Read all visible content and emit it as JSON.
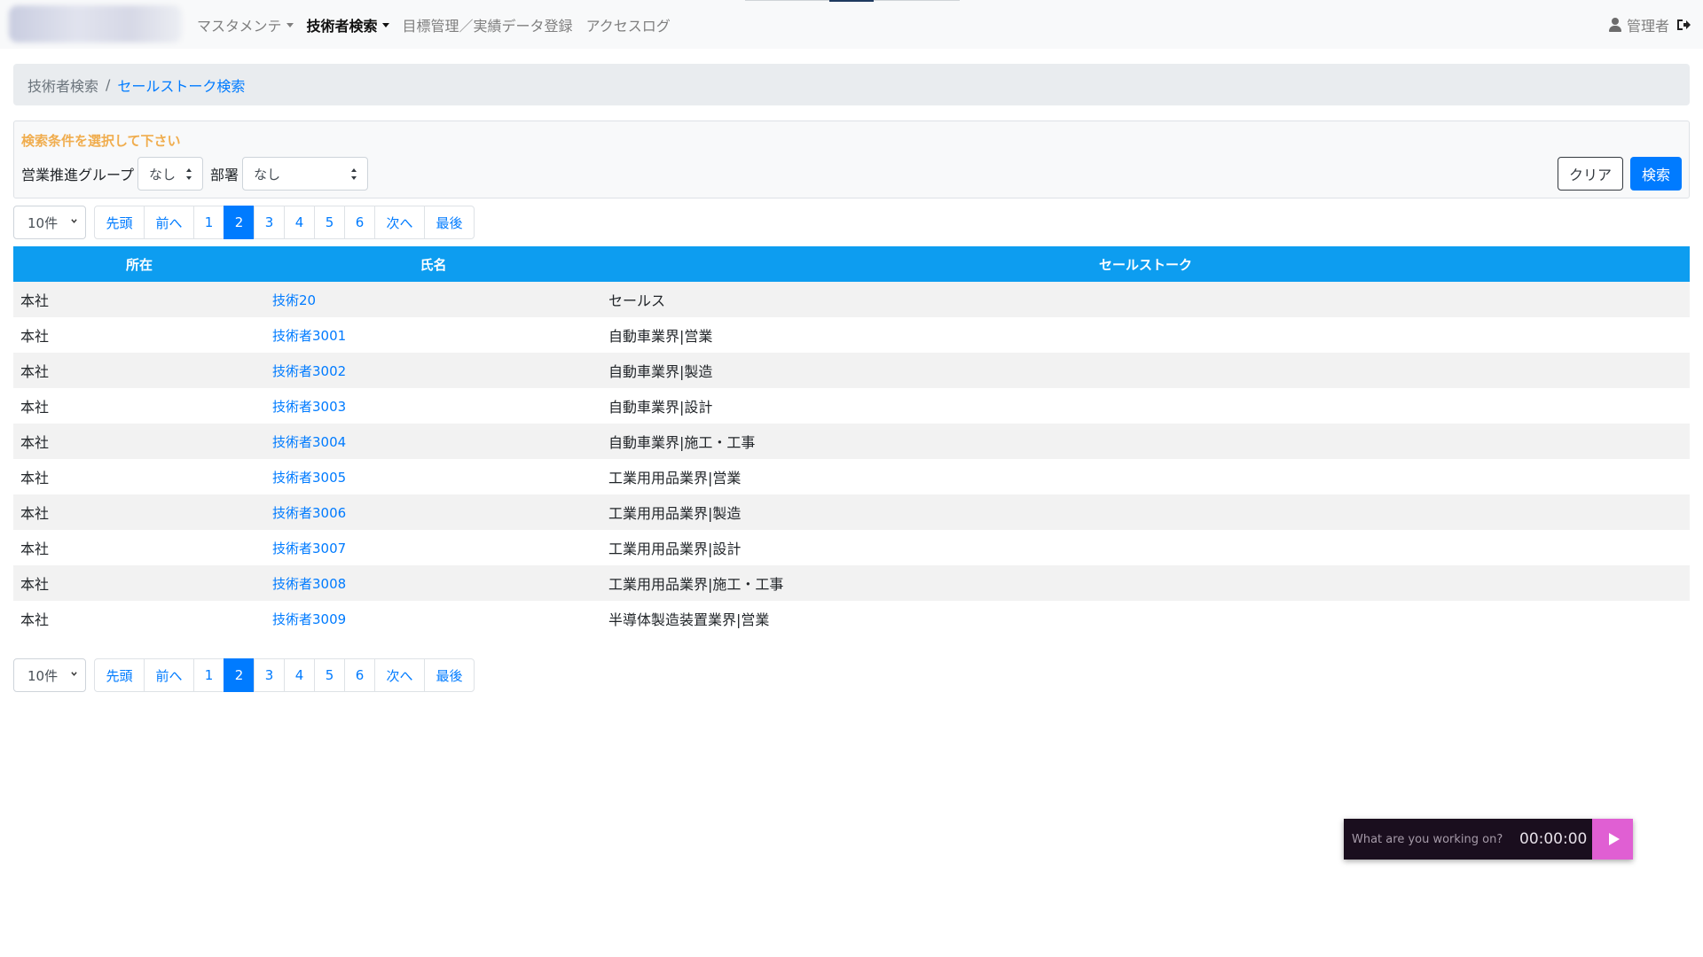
{
  "nav": {
    "items": [
      {
        "label": "マスタメンテ",
        "dropdown": true,
        "active": false
      },
      {
        "label": "技術者検索",
        "dropdown": true,
        "active": true
      },
      {
        "label": "目標管理／実績データ登録",
        "dropdown": false,
        "active": false
      },
      {
        "label": "アクセスログ",
        "dropdown": false,
        "active": false
      }
    ],
    "user_label": "管理者"
  },
  "breadcrumb": {
    "parent": "技術者検索",
    "separator": "/",
    "current": "セールストーク検索"
  },
  "search": {
    "hint": "検索条件を選択して下さい",
    "group_label": "営業推進グループ",
    "group_value": "なし",
    "dept_label": "部署",
    "dept_value": "なし",
    "clear_label": "クリア",
    "search_label": "検索"
  },
  "pagination": {
    "per_page": "10件",
    "first": "先頭",
    "prev": "前へ",
    "pages": [
      "1",
      "2",
      "3",
      "4",
      "5",
      "6"
    ],
    "current_page": "2",
    "next": "次へ",
    "last": "最後"
  },
  "table": {
    "headers": {
      "location": "所在",
      "name": "氏名",
      "talk": "セールストーク"
    },
    "rows": [
      {
        "location": "本社",
        "name": "技術20",
        "talk": "セールス"
      },
      {
        "location": "本社",
        "name": "技術者3001",
        "talk": "自動車業界|営業"
      },
      {
        "location": "本社",
        "name": "技術者3002",
        "talk": "自動車業界|製造"
      },
      {
        "location": "本社",
        "name": "技術者3003",
        "talk": "自動車業界|設計"
      },
      {
        "location": "本社",
        "name": "技術者3004",
        "talk": "自動車業界|施工・工事"
      },
      {
        "location": "本社",
        "name": "技術者3005",
        "talk": "工業用用品業界|営業"
      },
      {
        "location": "本社",
        "name": "技術者3006",
        "talk": "工業用用品業界|製造"
      },
      {
        "location": "本社",
        "name": "技術者3007",
        "talk": "工業用用品業界|設計"
      },
      {
        "location": "本社",
        "name": "技術者3008",
        "talk": "工業用用品業界|施工・工事"
      },
      {
        "location": "本社",
        "name": "技術者3009",
        "talk": "半導体製造装置業界|営業"
      }
    ]
  },
  "timer": {
    "placeholder": "What are you working on?",
    "time": "00:00:00"
  },
  "colors": {
    "primary": "#007bff",
    "table_header": "#0d9df0",
    "hint": "#f0ad4e",
    "timer_bg": "#1a0e1e",
    "timer_play": "#e05fd3"
  }
}
